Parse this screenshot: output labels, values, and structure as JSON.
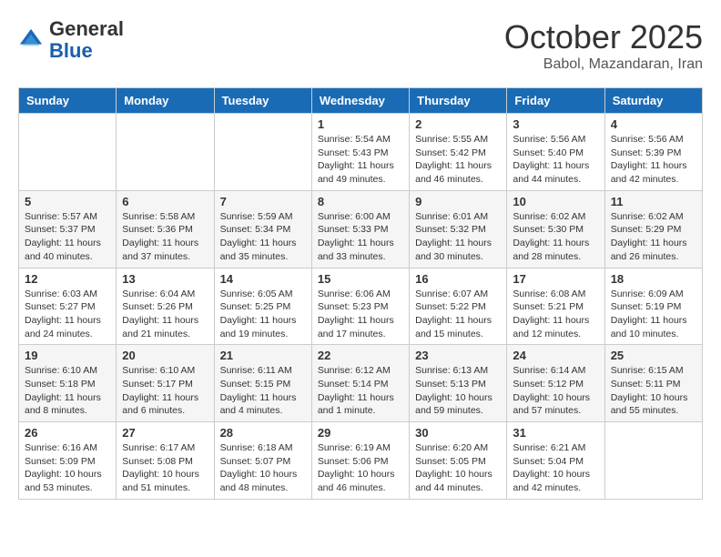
{
  "header": {
    "logo_general": "General",
    "logo_blue": "Blue",
    "month_title": "October 2025",
    "location": "Babol, Mazandaran, Iran"
  },
  "weekdays": [
    "Sunday",
    "Monday",
    "Tuesday",
    "Wednesday",
    "Thursday",
    "Friday",
    "Saturday"
  ],
  "weeks": [
    [
      {
        "day": "",
        "info": ""
      },
      {
        "day": "",
        "info": ""
      },
      {
        "day": "",
        "info": ""
      },
      {
        "day": "1",
        "info": "Sunrise: 5:54 AM\nSunset: 5:43 PM\nDaylight: 11 hours and 49 minutes."
      },
      {
        "day": "2",
        "info": "Sunrise: 5:55 AM\nSunset: 5:42 PM\nDaylight: 11 hours and 46 minutes."
      },
      {
        "day": "3",
        "info": "Sunrise: 5:56 AM\nSunset: 5:40 PM\nDaylight: 11 hours and 44 minutes."
      },
      {
        "day": "4",
        "info": "Sunrise: 5:56 AM\nSunset: 5:39 PM\nDaylight: 11 hours and 42 minutes."
      }
    ],
    [
      {
        "day": "5",
        "info": "Sunrise: 5:57 AM\nSunset: 5:37 PM\nDaylight: 11 hours and 40 minutes."
      },
      {
        "day": "6",
        "info": "Sunrise: 5:58 AM\nSunset: 5:36 PM\nDaylight: 11 hours and 37 minutes."
      },
      {
        "day": "7",
        "info": "Sunrise: 5:59 AM\nSunset: 5:34 PM\nDaylight: 11 hours and 35 minutes."
      },
      {
        "day": "8",
        "info": "Sunrise: 6:00 AM\nSunset: 5:33 PM\nDaylight: 11 hours and 33 minutes."
      },
      {
        "day": "9",
        "info": "Sunrise: 6:01 AM\nSunset: 5:32 PM\nDaylight: 11 hours and 30 minutes."
      },
      {
        "day": "10",
        "info": "Sunrise: 6:02 AM\nSunset: 5:30 PM\nDaylight: 11 hours and 28 minutes."
      },
      {
        "day": "11",
        "info": "Sunrise: 6:02 AM\nSunset: 5:29 PM\nDaylight: 11 hours and 26 minutes."
      }
    ],
    [
      {
        "day": "12",
        "info": "Sunrise: 6:03 AM\nSunset: 5:27 PM\nDaylight: 11 hours and 24 minutes."
      },
      {
        "day": "13",
        "info": "Sunrise: 6:04 AM\nSunset: 5:26 PM\nDaylight: 11 hours and 21 minutes."
      },
      {
        "day": "14",
        "info": "Sunrise: 6:05 AM\nSunset: 5:25 PM\nDaylight: 11 hours and 19 minutes."
      },
      {
        "day": "15",
        "info": "Sunrise: 6:06 AM\nSunset: 5:23 PM\nDaylight: 11 hours and 17 minutes."
      },
      {
        "day": "16",
        "info": "Sunrise: 6:07 AM\nSunset: 5:22 PM\nDaylight: 11 hours and 15 minutes."
      },
      {
        "day": "17",
        "info": "Sunrise: 6:08 AM\nSunset: 5:21 PM\nDaylight: 11 hours and 12 minutes."
      },
      {
        "day": "18",
        "info": "Sunrise: 6:09 AM\nSunset: 5:19 PM\nDaylight: 11 hours and 10 minutes."
      }
    ],
    [
      {
        "day": "19",
        "info": "Sunrise: 6:10 AM\nSunset: 5:18 PM\nDaylight: 11 hours and 8 minutes."
      },
      {
        "day": "20",
        "info": "Sunrise: 6:10 AM\nSunset: 5:17 PM\nDaylight: 11 hours and 6 minutes."
      },
      {
        "day": "21",
        "info": "Sunrise: 6:11 AM\nSunset: 5:15 PM\nDaylight: 11 hours and 4 minutes."
      },
      {
        "day": "22",
        "info": "Sunrise: 6:12 AM\nSunset: 5:14 PM\nDaylight: 11 hours and 1 minute."
      },
      {
        "day": "23",
        "info": "Sunrise: 6:13 AM\nSunset: 5:13 PM\nDaylight: 10 hours and 59 minutes."
      },
      {
        "day": "24",
        "info": "Sunrise: 6:14 AM\nSunset: 5:12 PM\nDaylight: 10 hours and 57 minutes."
      },
      {
        "day": "25",
        "info": "Sunrise: 6:15 AM\nSunset: 5:11 PM\nDaylight: 10 hours and 55 minutes."
      }
    ],
    [
      {
        "day": "26",
        "info": "Sunrise: 6:16 AM\nSunset: 5:09 PM\nDaylight: 10 hours and 53 minutes."
      },
      {
        "day": "27",
        "info": "Sunrise: 6:17 AM\nSunset: 5:08 PM\nDaylight: 10 hours and 51 minutes."
      },
      {
        "day": "28",
        "info": "Sunrise: 6:18 AM\nSunset: 5:07 PM\nDaylight: 10 hours and 48 minutes."
      },
      {
        "day": "29",
        "info": "Sunrise: 6:19 AM\nSunset: 5:06 PM\nDaylight: 10 hours and 46 minutes."
      },
      {
        "day": "30",
        "info": "Sunrise: 6:20 AM\nSunset: 5:05 PM\nDaylight: 10 hours and 44 minutes."
      },
      {
        "day": "31",
        "info": "Sunrise: 6:21 AM\nSunset: 5:04 PM\nDaylight: 10 hours and 42 minutes."
      },
      {
        "day": "",
        "info": ""
      }
    ]
  ]
}
